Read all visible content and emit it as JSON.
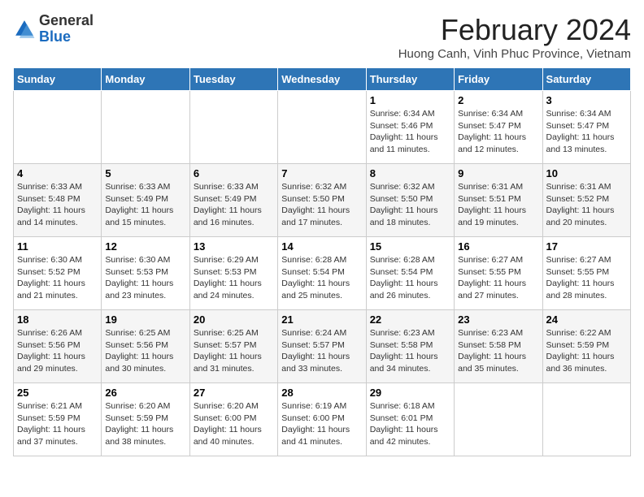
{
  "header": {
    "logo_general": "General",
    "logo_blue": "Blue",
    "title": "February 2024",
    "subtitle": "Huong Canh, Vinh Phuc Province, Vietnam"
  },
  "days_of_week": [
    "Sunday",
    "Monday",
    "Tuesday",
    "Wednesday",
    "Thursday",
    "Friday",
    "Saturday"
  ],
  "weeks": [
    [
      {
        "day": "",
        "info": ""
      },
      {
        "day": "",
        "info": ""
      },
      {
        "day": "",
        "info": ""
      },
      {
        "day": "",
        "info": ""
      },
      {
        "day": "1",
        "info": "Sunrise: 6:34 AM\nSunset: 5:46 PM\nDaylight: 11 hours and 11 minutes."
      },
      {
        "day": "2",
        "info": "Sunrise: 6:34 AM\nSunset: 5:47 PM\nDaylight: 11 hours and 12 minutes."
      },
      {
        "day": "3",
        "info": "Sunrise: 6:34 AM\nSunset: 5:47 PM\nDaylight: 11 hours and 13 minutes."
      }
    ],
    [
      {
        "day": "4",
        "info": "Sunrise: 6:33 AM\nSunset: 5:48 PM\nDaylight: 11 hours and 14 minutes."
      },
      {
        "day": "5",
        "info": "Sunrise: 6:33 AM\nSunset: 5:49 PM\nDaylight: 11 hours and 15 minutes."
      },
      {
        "day": "6",
        "info": "Sunrise: 6:33 AM\nSunset: 5:49 PM\nDaylight: 11 hours and 16 minutes."
      },
      {
        "day": "7",
        "info": "Sunrise: 6:32 AM\nSunset: 5:50 PM\nDaylight: 11 hours and 17 minutes."
      },
      {
        "day": "8",
        "info": "Sunrise: 6:32 AM\nSunset: 5:50 PM\nDaylight: 11 hours and 18 minutes."
      },
      {
        "day": "9",
        "info": "Sunrise: 6:31 AM\nSunset: 5:51 PM\nDaylight: 11 hours and 19 minutes."
      },
      {
        "day": "10",
        "info": "Sunrise: 6:31 AM\nSunset: 5:52 PM\nDaylight: 11 hours and 20 minutes."
      }
    ],
    [
      {
        "day": "11",
        "info": "Sunrise: 6:30 AM\nSunset: 5:52 PM\nDaylight: 11 hours and 21 minutes."
      },
      {
        "day": "12",
        "info": "Sunrise: 6:30 AM\nSunset: 5:53 PM\nDaylight: 11 hours and 23 minutes."
      },
      {
        "day": "13",
        "info": "Sunrise: 6:29 AM\nSunset: 5:53 PM\nDaylight: 11 hours and 24 minutes."
      },
      {
        "day": "14",
        "info": "Sunrise: 6:28 AM\nSunset: 5:54 PM\nDaylight: 11 hours and 25 minutes."
      },
      {
        "day": "15",
        "info": "Sunrise: 6:28 AM\nSunset: 5:54 PM\nDaylight: 11 hours and 26 minutes."
      },
      {
        "day": "16",
        "info": "Sunrise: 6:27 AM\nSunset: 5:55 PM\nDaylight: 11 hours and 27 minutes."
      },
      {
        "day": "17",
        "info": "Sunrise: 6:27 AM\nSunset: 5:55 PM\nDaylight: 11 hours and 28 minutes."
      }
    ],
    [
      {
        "day": "18",
        "info": "Sunrise: 6:26 AM\nSunset: 5:56 PM\nDaylight: 11 hours and 29 minutes."
      },
      {
        "day": "19",
        "info": "Sunrise: 6:25 AM\nSunset: 5:56 PM\nDaylight: 11 hours and 30 minutes."
      },
      {
        "day": "20",
        "info": "Sunrise: 6:25 AM\nSunset: 5:57 PM\nDaylight: 11 hours and 31 minutes."
      },
      {
        "day": "21",
        "info": "Sunrise: 6:24 AM\nSunset: 5:57 PM\nDaylight: 11 hours and 33 minutes."
      },
      {
        "day": "22",
        "info": "Sunrise: 6:23 AM\nSunset: 5:58 PM\nDaylight: 11 hours and 34 minutes."
      },
      {
        "day": "23",
        "info": "Sunrise: 6:23 AM\nSunset: 5:58 PM\nDaylight: 11 hours and 35 minutes."
      },
      {
        "day": "24",
        "info": "Sunrise: 6:22 AM\nSunset: 5:59 PM\nDaylight: 11 hours and 36 minutes."
      }
    ],
    [
      {
        "day": "25",
        "info": "Sunrise: 6:21 AM\nSunset: 5:59 PM\nDaylight: 11 hours and 37 minutes."
      },
      {
        "day": "26",
        "info": "Sunrise: 6:20 AM\nSunset: 5:59 PM\nDaylight: 11 hours and 38 minutes."
      },
      {
        "day": "27",
        "info": "Sunrise: 6:20 AM\nSunset: 6:00 PM\nDaylight: 11 hours and 40 minutes."
      },
      {
        "day": "28",
        "info": "Sunrise: 6:19 AM\nSunset: 6:00 PM\nDaylight: 11 hours and 41 minutes."
      },
      {
        "day": "29",
        "info": "Sunrise: 6:18 AM\nSunset: 6:01 PM\nDaylight: 11 hours and 42 minutes."
      },
      {
        "day": "",
        "info": ""
      },
      {
        "day": "",
        "info": ""
      }
    ]
  ]
}
